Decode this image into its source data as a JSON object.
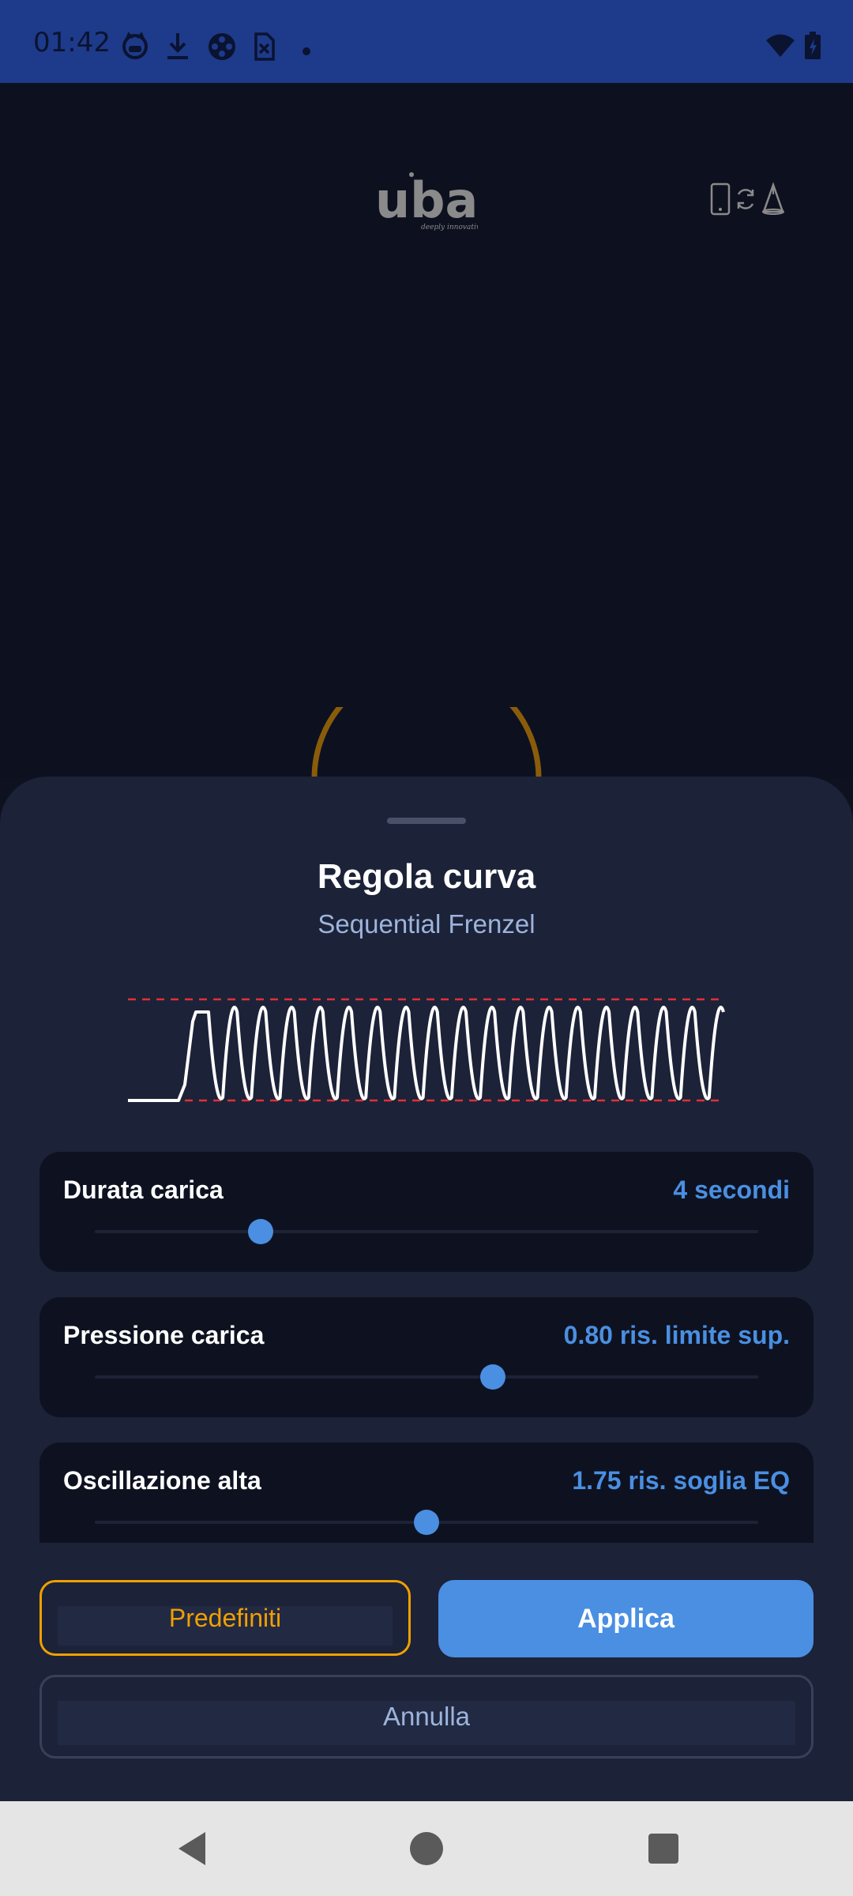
{
  "status_bar": {
    "time": "01:42",
    "left_icons": [
      "cat-icon",
      "download-icon",
      "gamepad-icon",
      "sim-off-icon",
      "dot-icon"
    ],
    "right_icons": [
      "wifi-icon",
      "battery-icon"
    ]
  },
  "header": {
    "logo_text": "uba",
    "logo_tagline": "deeply innovative",
    "icons": [
      "phone-icon",
      "sync-icon",
      "cone-icon"
    ]
  },
  "sheet": {
    "title": "Regola curva",
    "subtitle": "Sequential Frenzel",
    "sliders": [
      {
        "label": "Durata carica",
        "value": "4 secondi",
        "position": 0.25
      },
      {
        "label": "Pressione carica",
        "value": "0.80 ris. limite sup.",
        "position": 0.6
      },
      {
        "label": "Oscillazione alta",
        "value": "1.75 ris. soglia EQ",
        "position": 0.5
      }
    ],
    "buttons": {
      "defaults": "Predefiniti",
      "apply": "Applica",
      "cancel": "Annulla"
    }
  },
  "colors": {
    "accent": "#4a8fe2",
    "warning": "#f0a000",
    "limit_line": "#e0303a",
    "sheet_bg": "#1c2238",
    "status_bar": "#1e3a8a"
  },
  "navigation": {
    "icons": [
      "back-icon",
      "home-icon",
      "recents-icon"
    ]
  }
}
